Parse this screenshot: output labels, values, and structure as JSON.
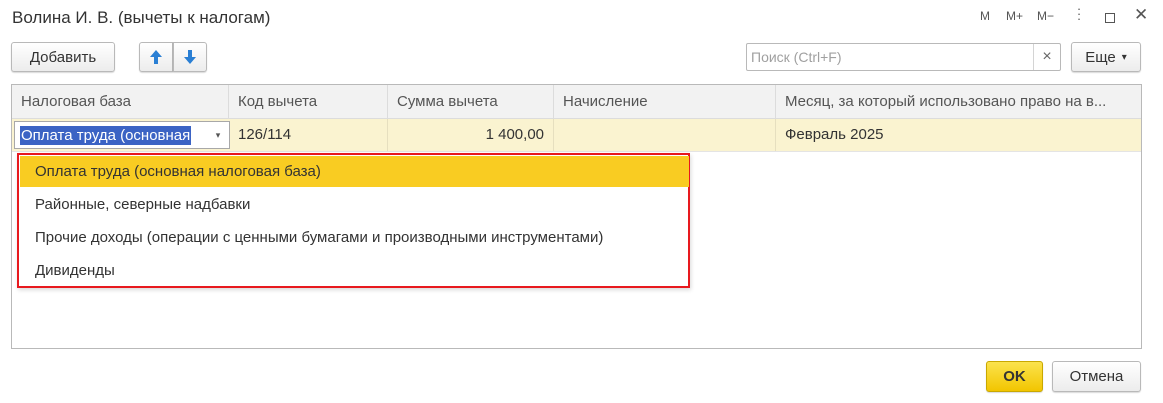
{
  "window": {
    "title": "Волина И. В. (вычеты к налогам)",
    "controls": {
      "m": "M",
      "m_plus": "M+",
      "m_minus": "M−",
      "more": "⋮",
      "close": "✕"
    }
  },
  "toolbar": {
    "add_label": "Добавить",
    "move_up_icon": "arrow-up-icon",
    "move_down_icon": "arrow-down-icon",
    "more_label": "Еще",
    "more_arrow": "▾"
  },
  "search": {
    "placeholder": "Поиск (Ctrl+F)",
    "value": "",
    "clear": "×"
  },
  "table": {
    "columns": [
      "Налоговая база",
      "Код вычета",
      "Сумма вычета",
      "Начисление",
      "Месяц, за который использовано право на в..."
    ],
    "row": {
      "tax_base": "Оплата труда (основная",
      "code": "126/114",
      "amount": "1 400,00",
      "accrual": "",
      "month": "Февраль 2025"
    },
    "dropdown_arrow": "▾"
  },
  "dropdown": {
    "items": [
      "Оплата труда (основная налоговая база)",
      "Районные, северные надбавки",
      "Прочие доходы (операции с ценными бумагами и производными инструментами)",
      "Дивиденды"
    ],
    "selected_index": 0
  },
  "footer": {
    "ok_label": "OK",
    "cancel_label": "Отмена"
  },
  "colors": {
    "accent_yellow": "#f9cc22",
    "row_highlight": "#faf3d0",
    "selection_blue": "#3b63c4",
    "annotation_red": "#e8191e",
    "arrow_blue": "#2a7fd4"
  }
}
